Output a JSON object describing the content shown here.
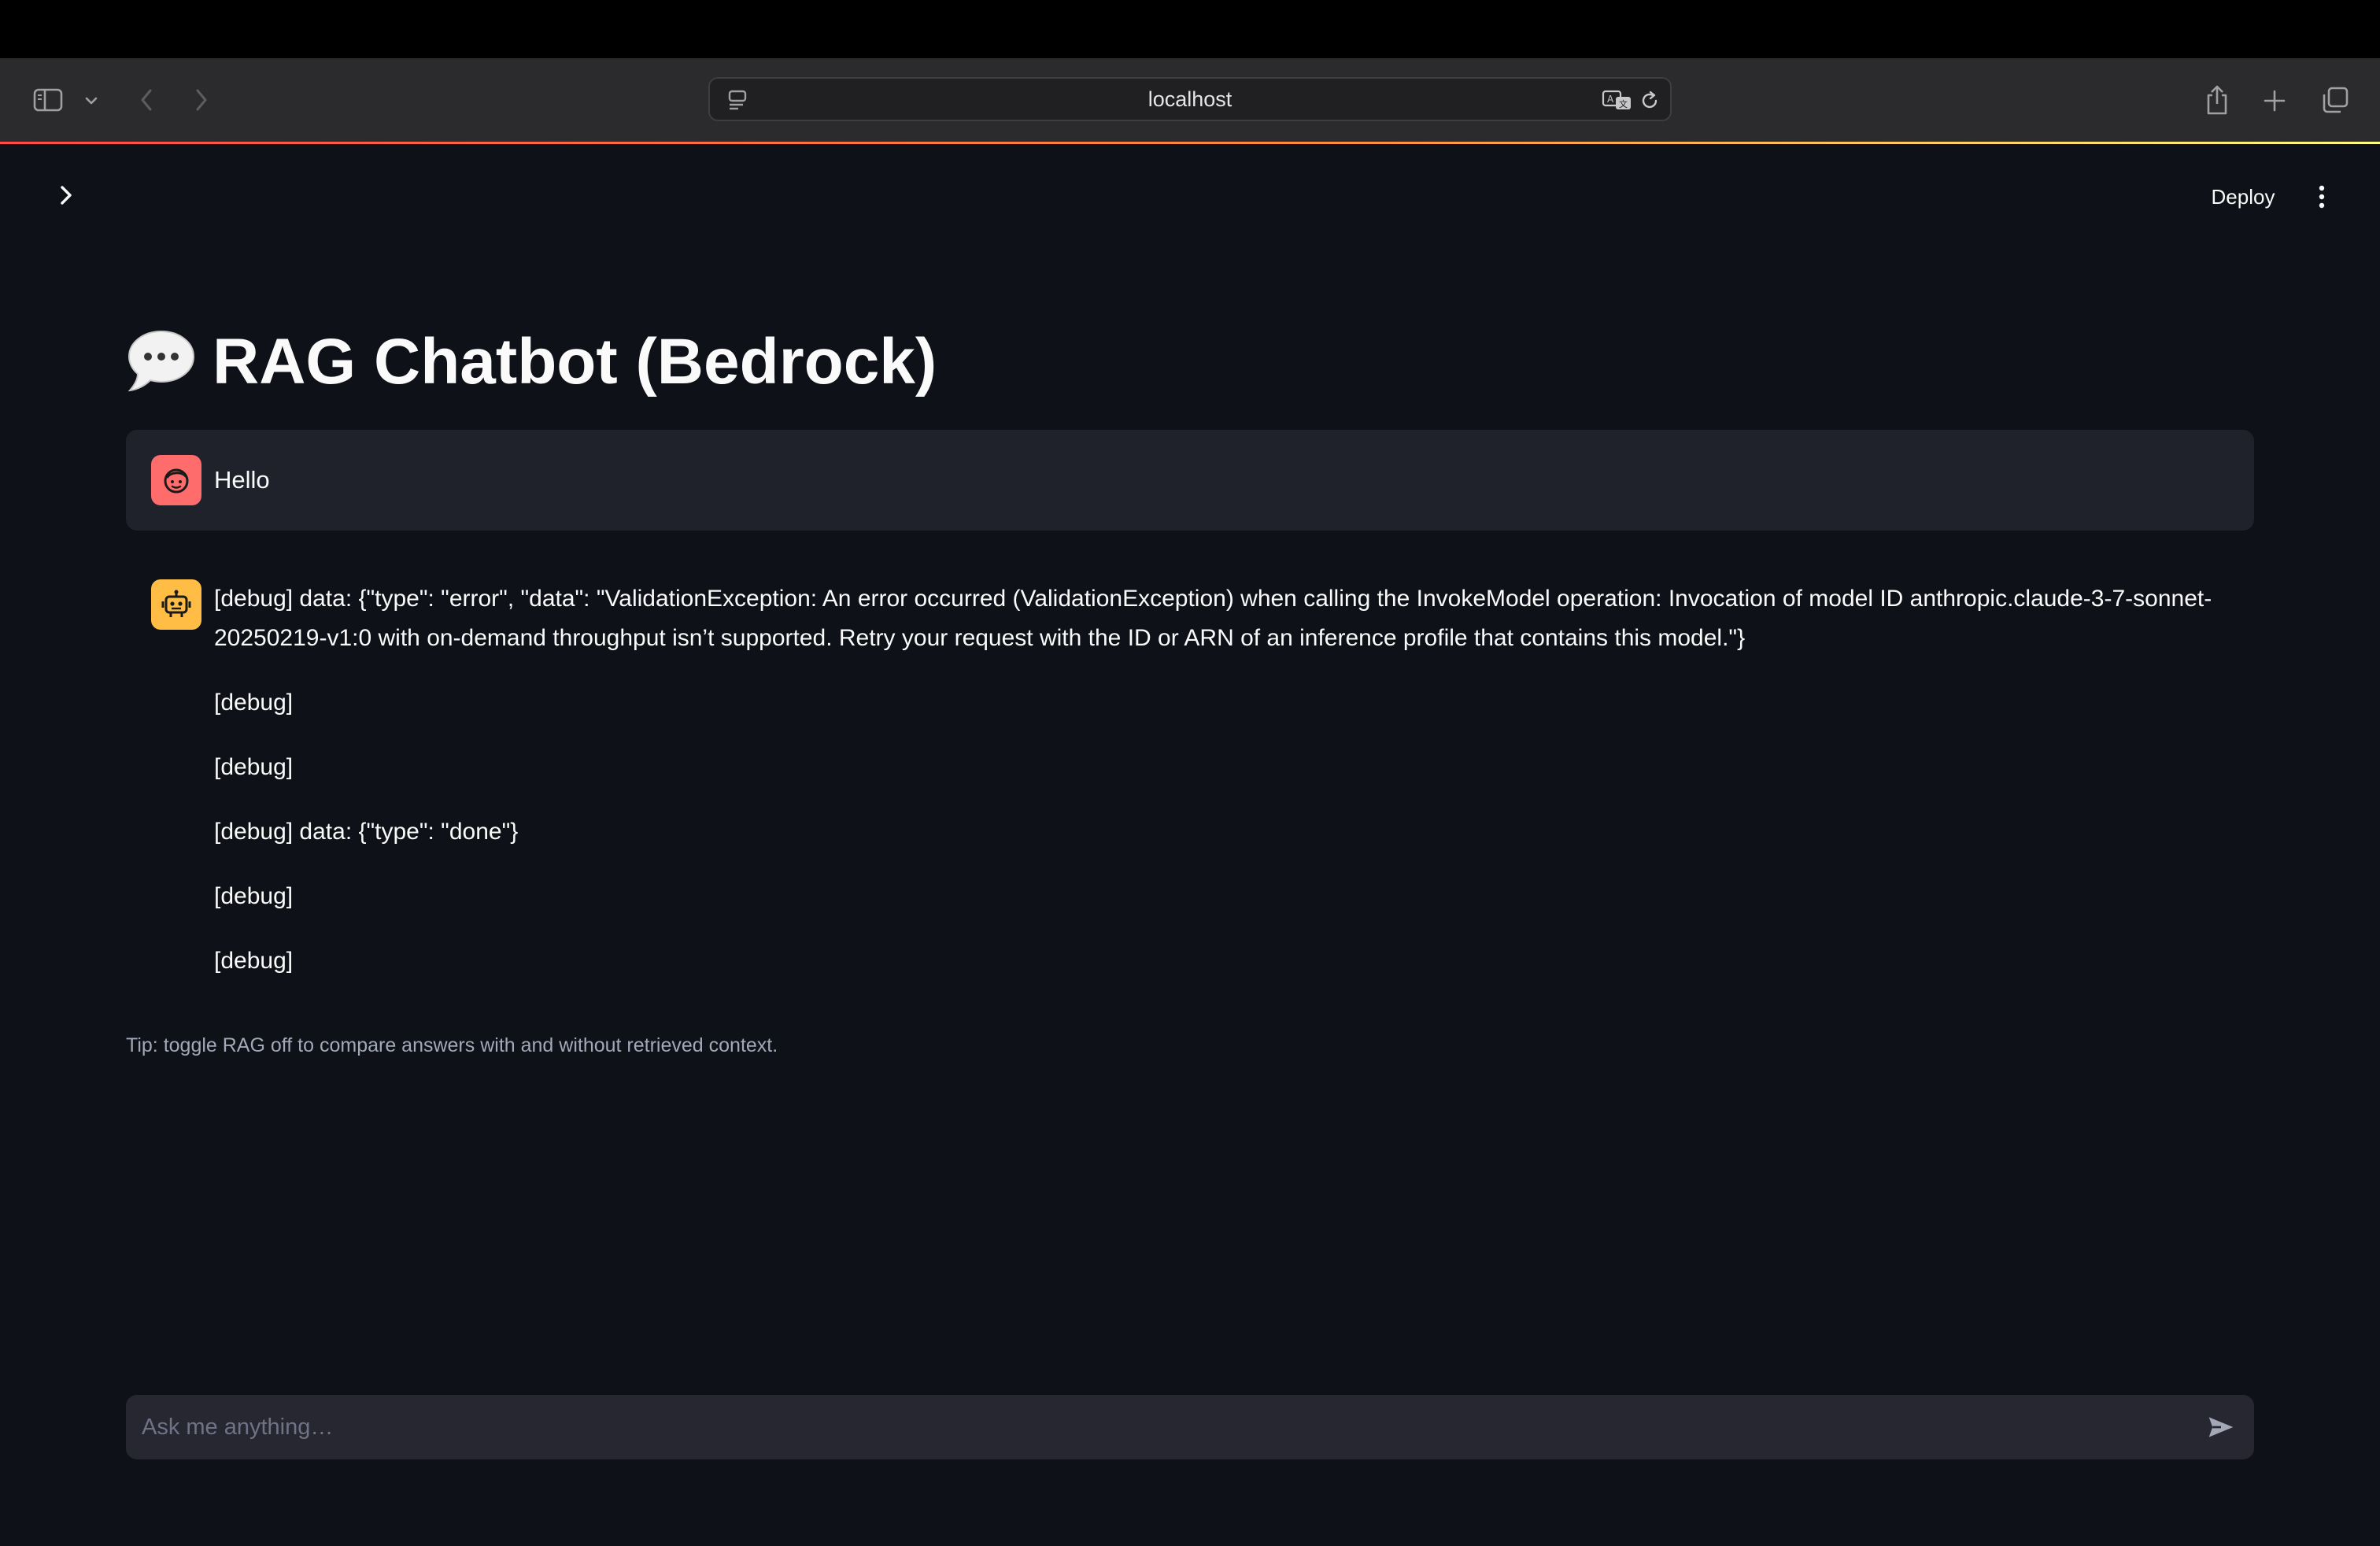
{
  "browser": {
    "address": "localhost",
    "icons": {
      "sidebar": "sidebar-icon",
      "sidebar_dropdown": "chevron-down-icon",
      "back": "chevron-left-icon",
      "forward": "chevron-right-icon",
      "site_info": "page-menu-icon",
      "translate": "translate-icon",
      "reload": "reload-icon",
      "share": "share-icon",
      "new_tab": "plus-icon",
      "tab_overview": "tabs-overview-icon"
    }
  },
  "header": {
    "deploy_label": "Deploy",
    "sidebar_icon": "chevron-right-icon",
    "menu_icon": "vertical-ellipsis-icon"
  },
  "main": {
    "title": "RAG Chatbot (Bedrock)",
    "title_icon": "speech-bubble-icon",
    "messages": [
      {
        "role": "user",
        "avatar": "user-face-icon",
        "lines": [
          "Hello"
        ]
      },
      {
        "role": "assistant",
        "avatar": "robot-icon",
        "lines": [
          "[debug] data: {\"type\": \"error\", \"data\": \"ValidationException: An error occurred (ValidationException) when calling the InvokeModel operation: Invocation of model ID anthropic.claude-3-7-sonnet-20250219-v1:0 with on-demand throughput isn’t supported. Retry your request with the ID or ARN of an inference profile that contains this model.\"}",
          "[debug]",
          "[debug]",
          "[debug] data: {\"type\": \"done\"}",
          "[debug]",
          "[debug]"
        ]
      }
    ],
    "tip": "Tip: toggle RAG off to compare answers with and without retrieved context."
  },
  "chat_input": {
    "placeholder": "Ask me anything…",
    "value": "",
    "send_icon": "send-icon"
  },
  "colors": {
    "background": "#0e1117",
    "user_avatar": "#ff6c6c",
    "assistant_avatar": "#ffbd45",
    "user_message_bg": "#1f222b",
    "input_bg": "#262730"
  }
}
